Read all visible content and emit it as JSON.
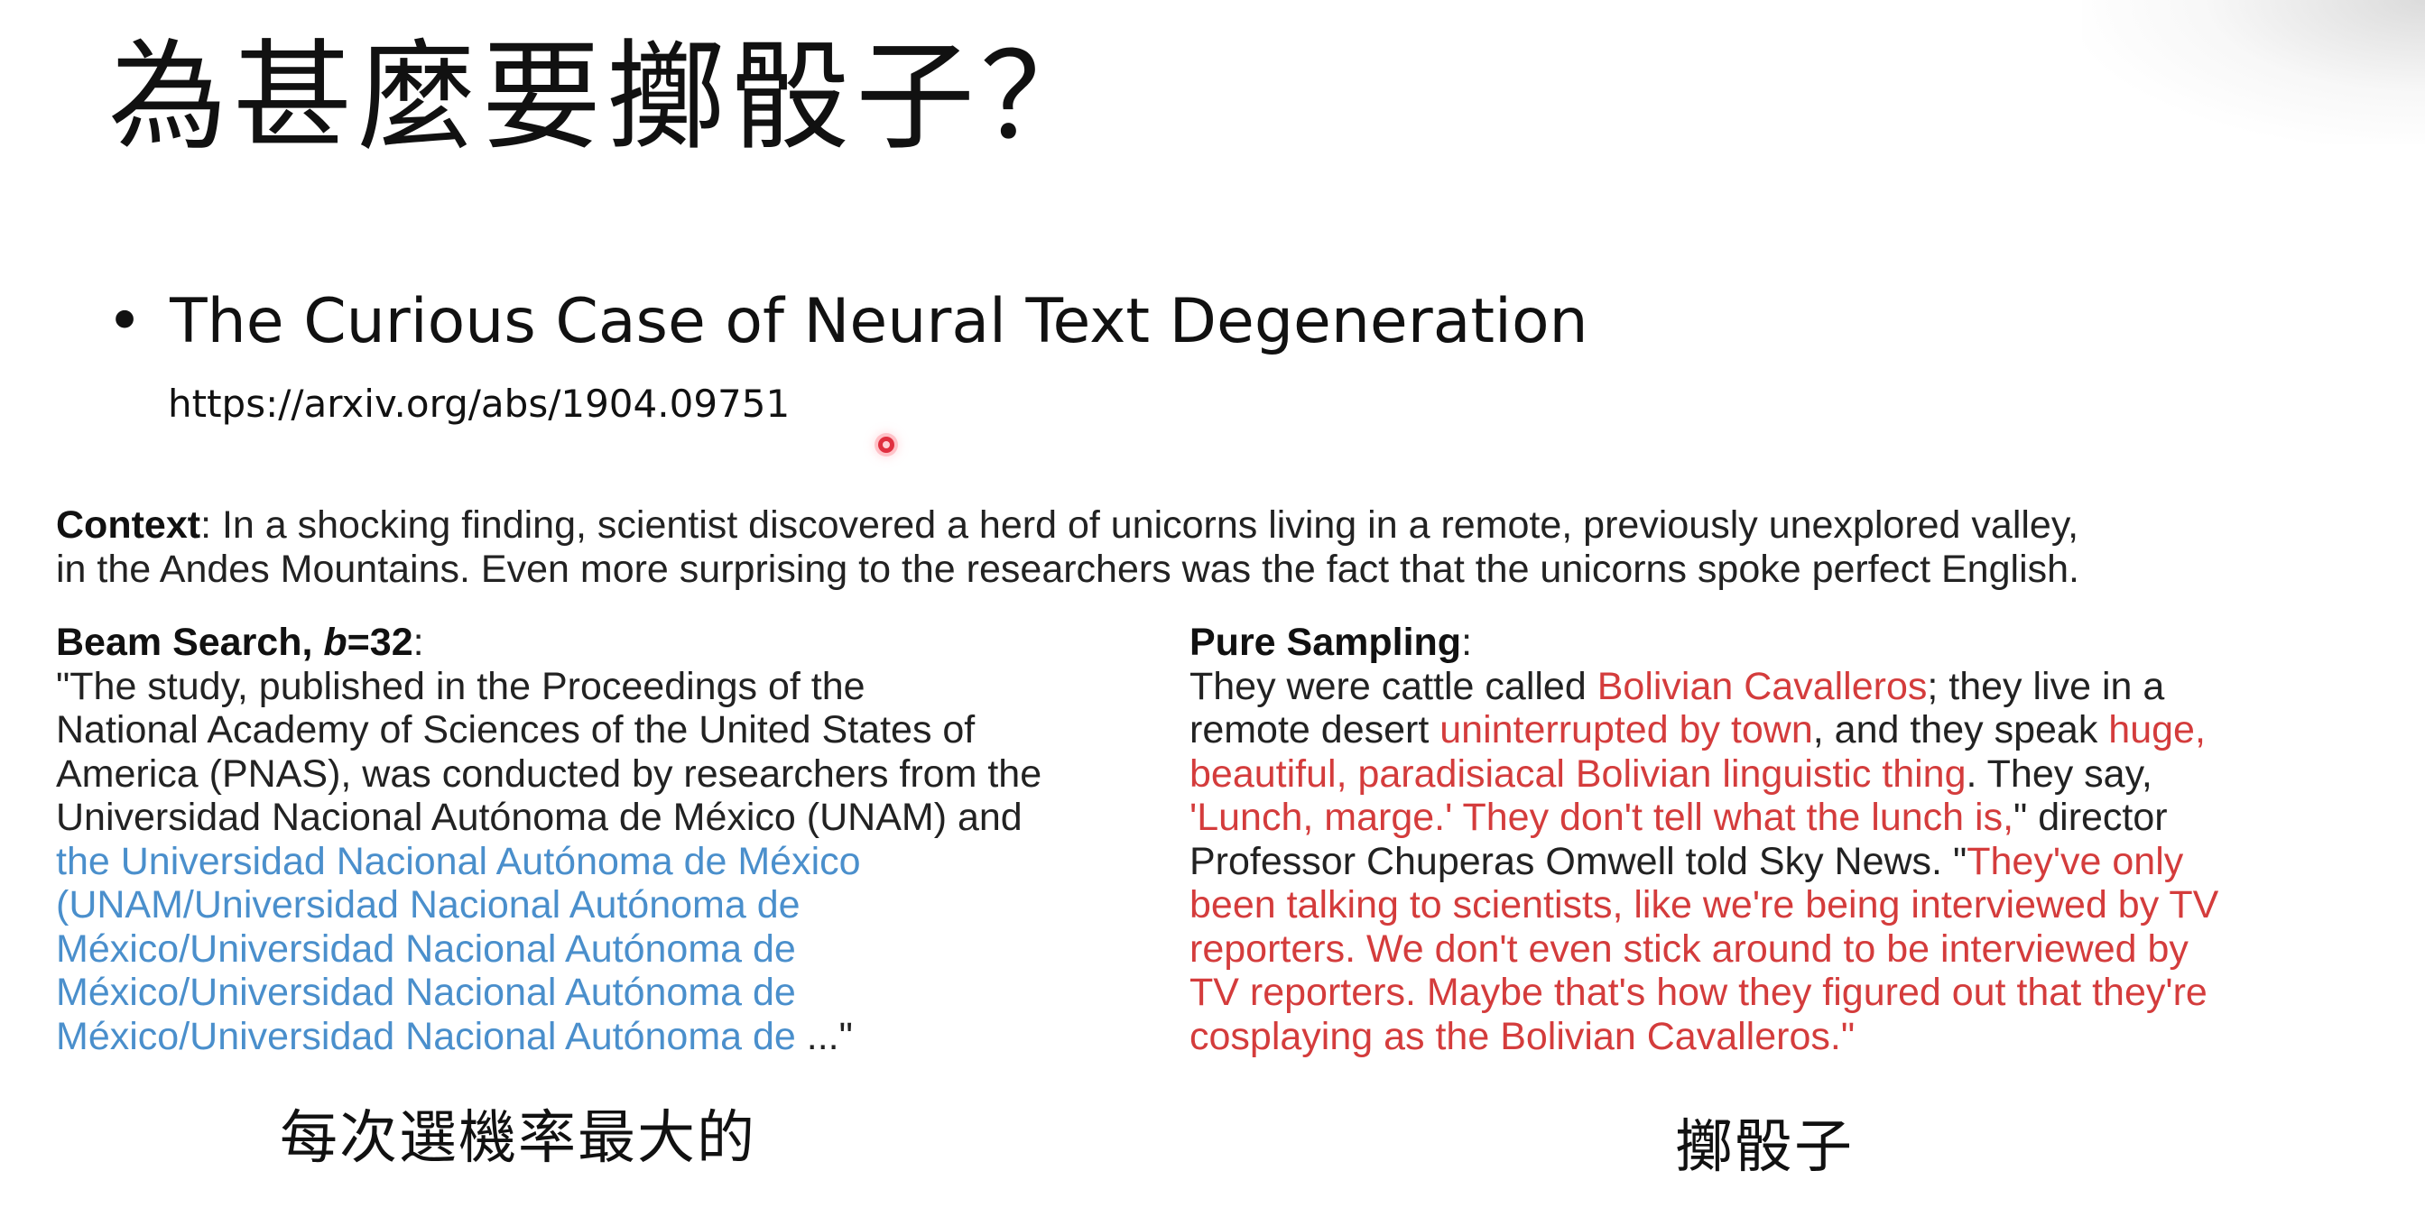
{
  "slide": {
    "title": "為甚麼要擲骰子？",
    "bullet_symbol": "•",
    "bullet_text": "The Curious Case of Neural Text Degeneration",
    "url": "https://arxiv.org/abs/1904.09751"
  },
  "figure": {
    "context": {
      "label": "Context",
      "sep": ": ",
      "line1": "In a shocking finding, scientist discovered a herd of unicorns living in a remote, previously unexplored valley,",
      "line2": "in the Andes Mountains. Even more surprising to the researchers was the fact that the unicorns spoke perfect English."
    },
    "beam": {
      "label_a": "Beam Search, ",
      "label_b": "b",
      "label_c": "=32",
      "label_sep": ":",
      "line1": "\"The study, published in the Proceedings of the",
      "line2": "National Academy of Sciences of the United States of",
      "line3": "America (PNAS), was conducted by researchers from the",
      "line4": "Universidad Nacional Autónoma de México (UNAM) and",
      "rep1": "the Universidad Nacional Autónoma de México",
      "rep2": "(UNAM/Universidad Nacional Autónoma de",
      "rep3": "México/Universidad Nacional Autónoma de",
      "rep4": "México/Universidad Nacional Autónoma de",
      "rep5": "México/Universidad Nacional Autónoma de",
      "ending": " ...\""
    },
    "sampling": {
      "label": "Pure Sampling",
      "label_sep": ":",
      "l1_a": "They were cattle called ",
      "l1_b": "Bolivian Cavalleros",
      "l1_c": "; they live in a",
      "l2_a": "remote desert ",
      "l2_b": "uninterrupted by town",
      "l2_c": ", and they speak ",
      "l2_d": "huge,",
      "l3_a": "beautiful, paradisiacal Bolivian linguistic thing",
      "l3_b": ". They say,",
      "l4_a": "'Lunch, marge.' They don't tell what the lunch is,",
      "l4_b": "\" director",
      "l5_a": "Professor Chuperas Omwell told Sky News. \"",
      "l5_b": "They've only",
      "l6": "been talking to scientists, like we're being interviewed by TV",
      "l7": "reporters. We don't even stick around to be interviewed by",
      "l8": "TV reporters. Maybe that's how they figured out that they're",
      "l9": "cosplaying as the Bolivian Cavalleros.\""
    }
  },
  "captions": {
    "left": "每次選機率最大的",
    "right": "擲骰子"
  },
  "colors": {
    "repetition_blue": "#4a8fcc",
    "sampling_red": "#d43c3c"
  }
}
